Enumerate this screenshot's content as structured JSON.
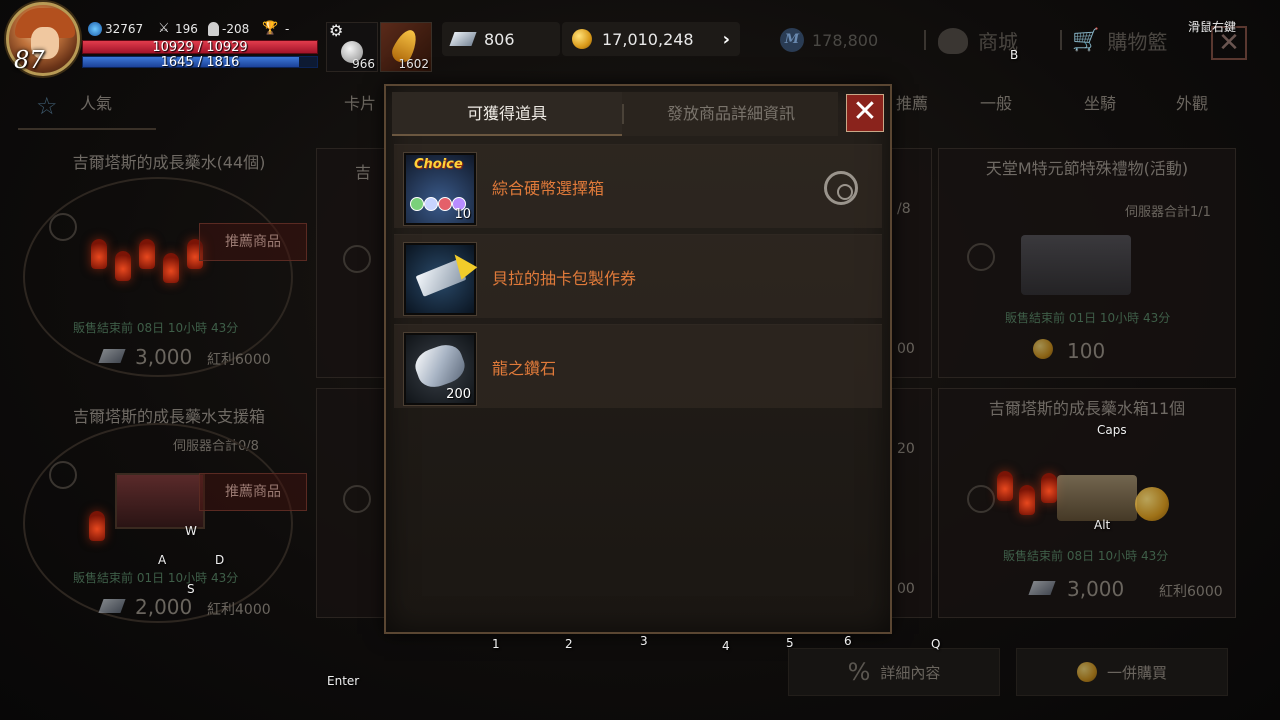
{
  "hud": {
    "level": "87",
    "power": "32767",
    "attack": "196",
    "defense": "-208",
    "trophy": "-",
    "hp": "10929 / 10929",
    "mp": "1645 / 1816",
    "slot1_count": "966",
    "slot2_count": "1602",
    "diamond": "806",
    "gold": "17,010,248",
    "mileage": "178,800",
    "shop_label": "商城",
    "cart_label": "購物籃",
    "right_hint": "滑鼠右鍵"
  },
  "categories": {
    "popular": "人氣",
    "tab2": "卡片",
    "tab_recommend": "推薦",
    "tab_general": "一般",
    "tab_mount": "坐騎",
    "tab_cosmetic": "外觀"
  },
  "cards": {
    "c1": {
      "title": "吉爾塔斯的成長藥水(44個)",
      "rec": "推薦商品",
      "time": "販售結束前 08日 10小時 43分",
      "price": "3,000",
      "bonus": "紅利6000"
    },
    "c2": {
      "title": "吉爾塔斯的成長藥水支援箱",
      "server": "伺服器合計0/8",
      "rec": "推薦商品",
      "time": "販售結束前 01日 10小時 43分",
      "price": "2,000",
      "bonus": "紅利4000"
    },
    "c3": {
      "title": "天堂M特元節特殊禮物(活動)",
      "server": "伺服器合計1/1",
      "time": "販售結束前 01日 10小時 43分",
      "price": "100"
    },
    "c4": {
      "title": "吉爾塔斯的成長藥水箱11個",
      "time": "販售結束前 08日 10小時 43分",
      "price": "3,000",
      "bonus": "紅利6000"
    },
    "c_mid_top_title": "吉",
    "c_mid_frac": "8",
    "c_mid_20": "20",
    "c_mid_00a": "00",
    "c_mid_00b": "00"
  },
  "modal": {
    "tab_active": "可獲得道具",
    "tab_inactive": "發放商品詳細資訊",
    "close": "✕",
    "items": [
      {
        "name": "綜合硬幣選擇箱",
        "count": "10",
        "badge": "Choice"
      },
      {
        "name": "貝拉的抽卡包製作券",
        "count": ""
      },
      {
        "name": "龍之鑽石",
        "count": "200"
      }
    ]
  },
  "bottom": {
    "details": "詳細內容",
    "buy_all": "一併購買"
  },
  "key_hints": {
    "b": "B",
    "caps": "Caps",
    "alt": "Alt",
    "w": "W",
    "a": "A",
    "s": "S",
    "d": "D",
    "k1": "1",
    "k2": "2",
    "k3": "3",
    "k4": "4",
    "k5": "5",
    "k6": "6",
    "q": "Q",
    "enter": "Enter"
  },
  "colors": {
    "accent_orange": "#e07a3a",
    "close_red": "#8a231c",
    "hp": "#e23c4c",
    "mp": "#3c78d8"
  }
}
